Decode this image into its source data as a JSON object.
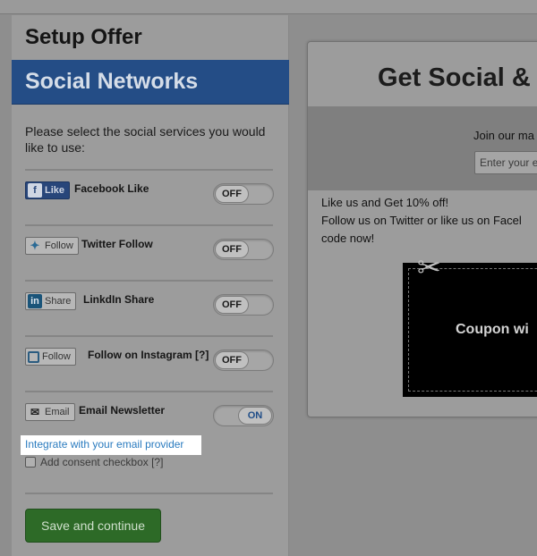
{
  "sidebar": {
    "title": "Setup Offer",
    "section_title": "Social Networks",
    "instruction": "Please select the social services you would like to use:",
    "services": [
      {
        "badge": "Like",
        "badge_icon": "facebook-icon",
        "label": "Facebook Like",
        "toggle": "OFF"
      },
      {
        "badge": "Follow",
        "badge_icon": "twitter-bird-icon",
        "label": "Twitter Follow",
        "toggle": "OFF"
      },
      {
        "badge": "Share",
        "badge_icon": "linkedin-icon",
        "label": "LinkdIn Share",
        "toggle": "OFF"
      },
      {
        "badge": "Follow",
        "badge_icon": "instagram-icon",
        "label": "Follow on Instagram [?]",
        "toggle": "OFF"
      },
      {
        "badge": "Email",
        "badge_icon": "envelope-icon",
        "label": "Email Newsletter",
        "toggle": "ON"
      }
    ],
    "integrate_link": "Integrate with your email provider",
    "consent_label": "Add consent checkbox [?]",
    "save_button": "Save and continue"
  },
  "preview": {
    "title": "Get Social &",
    "join_text": "Join our ma",
    "email_placeholder": "Enter your e",
    "line1": "Like us and Get 10% off!",
    "line2": "Follow us on Twitter or like us on Facel",
    "line3": "code now!",
    "coupon_text": "Coupon wi"
  },
  "colors": {
    "section_header": "#244d86",
    "save_button": "#2d6a27",
    "link": "#2a7bbf",
    "toggle_on_text": "#1f4d88"
  }
}
